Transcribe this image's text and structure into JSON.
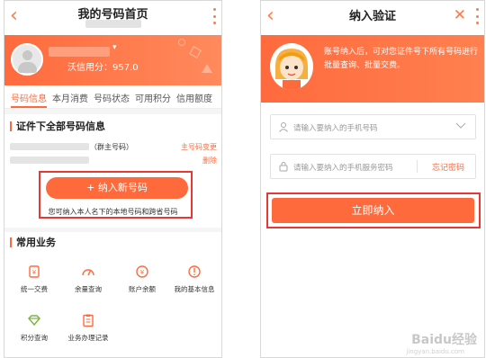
{
  "left": {
    "title": "我的号码首页",
    "credit": "沃信用分：957.0",
    "tabs": [
      "号码信息",
      "本月消费",
      "号码状态",
      "可用积分",
      "信用额度"
    ],
    "section_title": "证件下全部号码信息",
    "primary_tag": "（群主号码）",
    "change_main": "主号码变更",
    "delete": "删除",
    "add_button": "+ 纳入新号码",
    "hint": "您可纳入本人名下的本地号码和跨省号码",
    "services_title": "常用业务",
    "services": [
      {
        "label": "统一交费",
        "icon": "payment-icon"
      },
      {
        "label": "余量查询",
        "icon": "usage-icon"
      },
      {
        "label": "账户余额",
        "icon": "balance-icon"
      },
      {
        "label": "我的基本信息",
        "icon": "info-icon"
      },
      {
        "label": "积分查询",
        "icon": "points-icon"
      },
      {
        "label": "业务办理记录",
        "icon": "record-icon"
      }
    ]
  },
  "right": {
    "title": "纳入验证",
    "banner_text": "账号纳入后，可对您证件号下所有号码进行批量查询、批量交费。",
    "phone_placeholder": "请输入要纳入的手机号码",
    "password_placeholder": "请输入要纳入的手机服务密码",
    "forgot": "忘记密码",
    "join_button": "立即纳入"
  },
  "watermark": "Baidu经验",
  "watermark_sub": "jingyan.baidu.com",
  "colors": {
    "accent": "#ff6a3d",
    "highlight_box": "#e53935"
  }
}
